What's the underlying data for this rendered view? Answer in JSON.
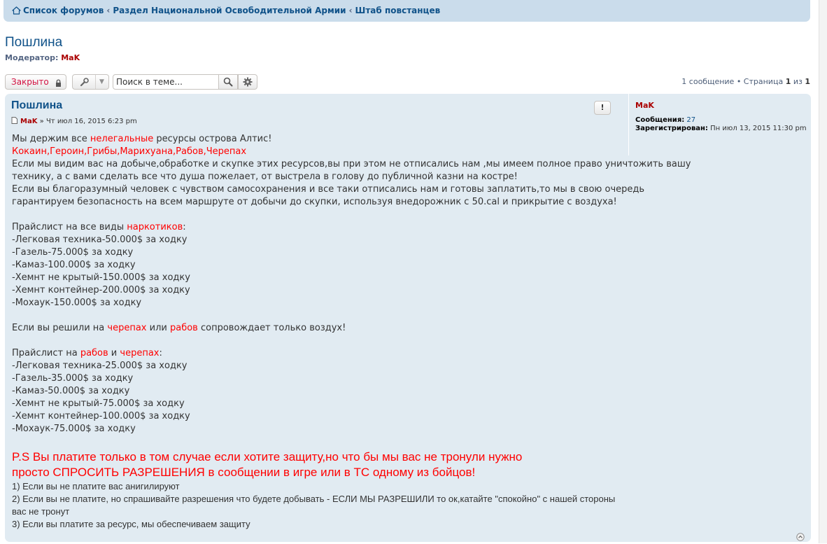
{
  "breadcrumbs": [
    "Список форумов",
    "Раздел Национальной Освободительной Армии",
    "Штаб повстанцев"
  ],
  "topic": {
    "title": "Пошлина",
    "moderator_label": "Модератор:",
    "moderator_name": "MaK"
  },
  "toolbar": {
    "locked_label": "Закрыто",
    "search_placeholder": "Поиск в теме..."
  },
  "pagination": {
    "count_text": "1 сообщение • Страница",
    "current": "1",
    "of": "из",
    "total": "1"
  },
  "post": {
    "title": "Пошлина",
    "author": "MaK",
    "sep": "»",
    "date": "Чт июл 16, 2015 6:23 pm",
    "report_label": "!",
    "content": {
      "l1a": "Мы держим все ",
      "l1b": "нелегальные",
      "l1c": " ресурсы острова Алтис!",
      "l2": "Кокаин,Героин,Грибы,Марихуана,Рабов,Черепах",
      "l3": "Если мы видим вас на добыче,обработке и скупке этих ресурсов,вы при этом не отписались нам ,мы имеем полное право уничтожить вашу",
      "l4": "технику, а с вами сделать все что душа пожелает, от выстрела в голову до публичной казни на костре!",
      "l5": "Если вы благоразумный человек с чувством самосохранения и все таки отписались нам и готовы заплатить,то мы в свою очередь",
      "l6": "гарантируем безопасность на всем маршруте от добычи до скупки, используя внедорожник с 50.cal и прикрытие с воздуха!",
      "price1a": "Прайслист на все виды ",
      "price1b": "наркотиков",
      "price1c": ":",
      "price1_items": [
        "-Легковая техника-50.000$ за ходку",
        "-Газель-75.000$ за ходку",
        "-Камаз-100.000$ за ходку",
        "-Хемнт не крытый-150.000$ за ходку",
        "-Хемнт контейнер-200.000$ за ходку",
        "-Мохаук-150.000$ за ходку"
      ],
      "air_a": "Если вы решили на ",
      "air_b": "черепах",
      "air_c": " или ",
      "air_d": "рабов",
      "air_e": " сопровождает только воздух!",
      "price2a": "Прайслист на ",
      "price2b": "рабов",
      "price2c": " и ",
      "price2d": "черепах",
      "price2e": ":",
      "price2_items": [
        "-Легковая техника-25.000$ за ходку",
        "-Газель-35.000$ за ходку",
        "-Камаз-50.000$ за ходку",
        "-Хемнт не крытый-75.000$ за ходку",
        "-Хемнт контейнер-100.000$ за ходку",
        "-Мохаук-75.000$ за ходку"
      ],
      "ps1": "P.S Вы платите только в том случае если хотите защиту,но что бы мы вас не тронули нужно",
      "ps2": "просто СПРОСИТЬ РАЗРЕШЕНИЯ в сообщении в игре или в ТС одному из бойцов!",
      "r1": "1) Если вы не платите вас анигилируют",
      "r2": "2) Если вы не платите, но спрашивайте разрешения что будете добывать - ЕСЛИ МЫ РАЗРЕШИЛИ то ок,катайте \"спокойно\" с нашей стороны",
      "r2b": "вас не тронут",
      "r3": "3) Если вы платите за ресурс, мы обеспечиваем защиту"
    }
  },
  "profile": {
    "name": "MaK",
    "posts_label": "Сообщения:",
    "posts_value": "27",
    "registered_label": "Зарегистрирован:",
    "registered_value": "Пн июл 13, 2015 11:30 pm"
  },
  "colors": {
    "link": "#105289",
    "moderator": "#AA0000",
    "highlight": "#ff0000",
    "post_bg": "#e1ebf2",
    "nav_bg": "#cadceb"
  }
}
